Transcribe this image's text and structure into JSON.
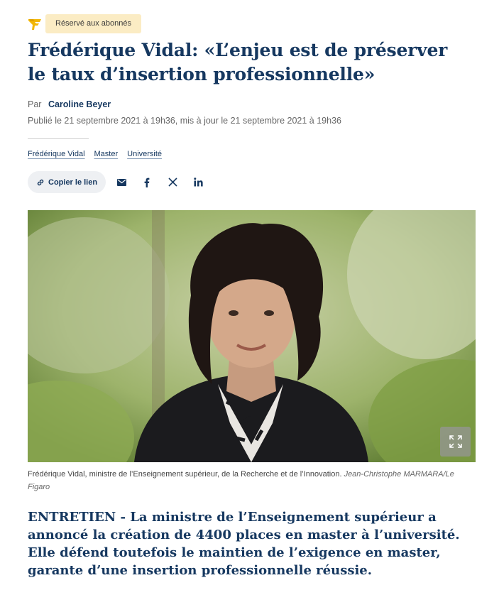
{
  "premium": {
    "badge_label": "Réservé aux abonnés",
    "logo_icon": "figaro-f-logo",
    "accent": "#f2b705"
  },
  "article": {
    "title_line1": "Frédérique Vidal: «L’enjeu est de préserver",
    "title_line2": "le taux d’insertion professionnelle»",
    "by_label": "Par",
    "author": "Caroline Beyer",
    "dateline": "Publié le 21 septembre 2021 à 19h36, mis à jour le 21 septembre 2021 à 19h36",
    "lead": "ENTRETIEN - La ministre de l’Enseignement supérieur a annoncé la création de 4400 places en master à l’université. Elle défend toutefois le maintien de l’exigence en master, garante d’une insertion professionnelle réussie."
  },
  "tags": [
    "Frédérique Vidal",
    "Master",
    "Université"
  ],
  "share": {
    "copy_label": "Copier le lien",
    "icons": [
      "mail-icon",
      "facebook-icon",
      "x-icon",
      "linkedin-icon"
    ]
  },
  "photo": {
    "caption": "Frédérique Vidal, ministre de l’Enseignement supérieur, de la Recherche et de l’Innovation.",
    "credit": "Jean-Christophe MARMARA/Le Figaro"
  },
  "colors": {
    "primary": "#163860",
    "badge_bg": "#fbecc4",
    "muted": "#666666"
  }
}
